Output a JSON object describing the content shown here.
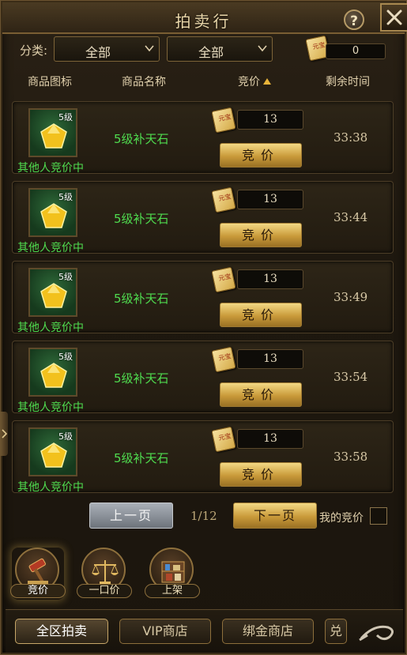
{
  "window": {
    "title": "拍卖行",
    "help_label": "?"
  },
  "filters": {
    "label": "分类:",
    "category_value": "全部",
    "subcategory_value": "全部",
    "coin_label": "元宝",
    "balance": "0"
  },
  "columns": {
    "icon": "商品图标",
    "name": "商品名称",
    "price": "竞价",
    "time_left": "剩余时间"
  },
  "listings": [
    {
      "level": "5级",
      "status": "其他人竞价中",
      "name": "5级补天石",
      "price": "13",
      "bid_label": "竞价",
      "time": "33:38"
    },
    {
      "level": "5级",
      "status": "其他人竞价中",
      "name": "5级补天石",
      "price": "13",
      "bid_label": "竞价",
      "time": "33:44"
    },
    {
      "level": "5级",
      "status": "其他人竞价中",
      "name": "5级补天石",
      "price": "13",
      "bid_label": "竞价",
      "time": "33:49"
    },
    {
      "level": "5级",
      "status": "其他人竞价中",
      "name": "5级补天石",
      "price": "13",
      "bid_label": "竞价",
      "time": "33:54"
    },
    {
      "level": "5级",
      "status": "其他人竞价中",
      "name": "5级补天石",
      "price": "13",
      "bid_label": "竞价",
      "time": "33:58"
    }
  ],
  "pagination": {
    "prev_label": "上一页",
    "page_indicator": "1/12",
    "next_label": "下一页",
    "my_bids_label": "我的竞价",
    "my_bids_checked": false
  },
  "modes": [
    {
      "label": "竞价",
      "icon": "gavel-icon",
      "active": true
    },
    {
      "label": "一口价",
      "icon": "scale-icon",
      "active": false
    },
    {
      "label": "上架",
      "icon": "shop-shelf-icon",
      "active": false
    }
  ],
  "shop_tabs": [
    {
      "label": "全区拍卖",
      "active": true
    },
    {
      "label": "VIP商店",
      "active": false
    },
    {
      "label": "绑金商店",
      "active": false
    },
    {
      "label": "兑",
      "active": false
    }
  ],
  "colors": {
    "item_name": "#4fdc4f",
    "gold_button": "#c99a3a",
    "frame_border": "#7a5e33"
  }
}
